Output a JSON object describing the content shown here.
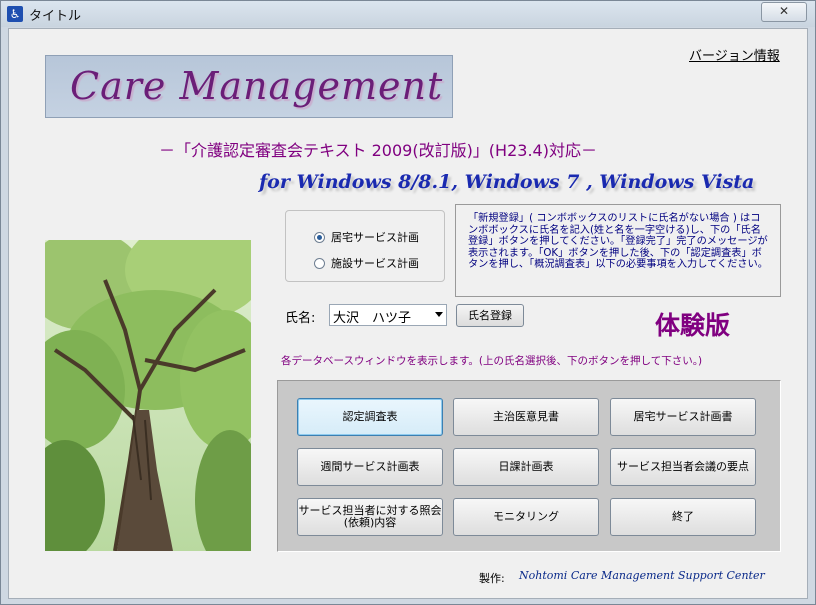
{
  "window": {
    "title": "タイトル",
    "close_glyph": "✕"
  },
  "header": {
    "version_link": "バージョン情報",
    "logo_text": "Care Management",
    "subtitle": "－「介護認定審査会テキスト 2009(改訂版)」(H23.4)対応－",
    "platforms": "for Windows 8/8.1, Windows 7 , Windows Vista"
  },
  "plan_type": {
    "options": [
      "居宅サービス計画",
      "施設サービス計画"
    ],
    "selected_index": 0
  },
  "info_text": "「新規登録」( コンボボックスのリストに氏名がない場合 ) はコンボボックスに氏名を記入(姓と名を一字空ける)し、下の「氏名登録」ボタンを押してください。「登録完了」完了のメッセージが表示されます。「OK」ボタンを押した後、下の「認定調査表」ボタンを押し、「概況調査表」以下の必要事項を入力してください。",
  "name": {
    "label": "氏名:",
    "value": "大沢　ハツ子",
    "register_button": "氏名登録"
  },
  "trial_label": "体験版",
  "db_note": "各データベースウィンドウを表示します。(上の氏名選択後、下のボタンを押して下さい。)",
  "buttons": [
    "認定調査表",
    "主治医意見書",
    "居宅サービス計画書",
    "週間サービス計画表",
    "日課計画表",
    "サービス担当者会議の要点",
    "サービス担当者に対する照会(依頼)内容",
    "モニタリング",
    "終了"
  ],
  "footer": {
    "credit_label": "製作:",
    "organization": "Nohtomi Care Management Support Center"
  },
  "icons": {
    "app": "accessibility-icon",
    "radio": "radio-icon",
    "dropdown": "chevron-down-icon"
  },
  "colors": {
    "accent_purple": "#800080",
    "platform_blue": "#1a2ab0",
    "info_blue": "#000080"
  }
}
